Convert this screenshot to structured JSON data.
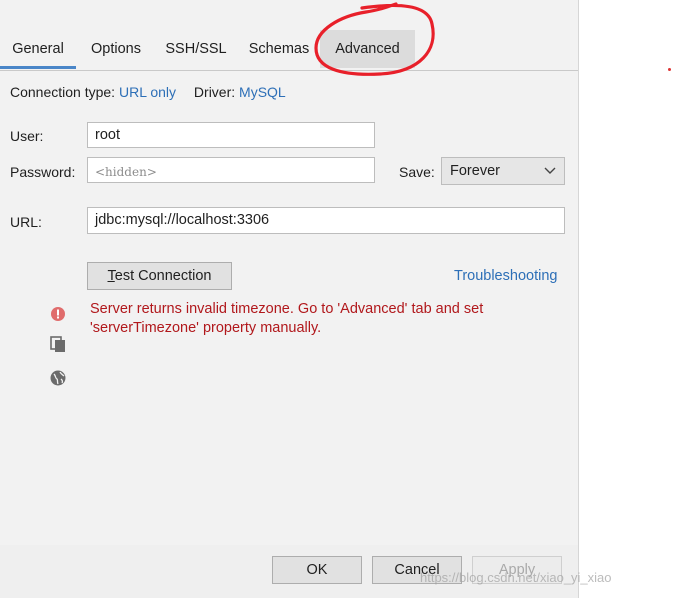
{
  "tabs": [
    {
      "label": "General"
    },
    {
      "label": "Options"
    },
    {
      "label": "SSH/SSL"
    },
    {
      "label": "Schemas"
    },
    {
      "label": "Advanced"
    }
  ],
  "connection": {
    "type_label": "Connection type:",
    "type_value": "URL only",
    "driver_label": "Driver:",
    "driver_value": "MySQL"
  },
  "form": {
    "user_label": "User:",
    "user_value": "root",
    "password_label": "Password:",
    "password_placeholder": "<hidden>",
    "save_label": "Save:",
    "save_value": "Forever",
    "url_label": "URL:",
    "url_value": "jdbc:mysql://localhost:3306"
  },
  "actions": {
    "test_connection_prefix": "T",
    "test_connection_rest": "est Connection",
    "troubleshooting": "Troubleshooting"
  },
  "error": {
    "message": "Server returns invalid timezone. Go to 'Advanced' tab and set 'serverTimezone' property manually."
  },
  "footer": {
    "ok": "OK",
    "cancel": "Cancel",
    "apply": "Apply"
  },
  "watermark": "https://blog.csdn.net/xiao_yi_xiao",
  "colors": {
    "link": "#2d6fb7",
    "error": "#b1181c",
    "tab_underline": "#4a86c8",
    "annotation": "#e8202a"
  },
  "icons": {
    "error": "error-circle-icon",
    "copy": "copy-icon",
    "globe": "globe-icon"
  }
}
